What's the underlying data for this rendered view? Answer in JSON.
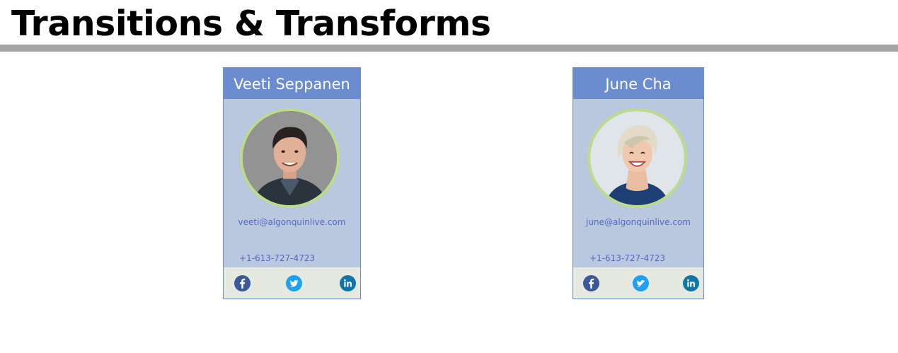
{
  "page": {
    "title": "Transitions & Transforms"
  },
  "cards": [
    {
      "name": "Veeti Seppanen",
      "email": "veeti@algonquinlive.com",
      "phone": "+1-613-727-4723"
    },
    {
      "name": "June Cha",
      "email": "june@algonquinlive.com",
      "phone": "+1-613-727-4723"
    }
  ],
  "icons": {
    "facebook": "facebook-icon",
    "twitter": "twitter-icon",
    "linkedin": "linkedin-icon"
  },
  "colors": {
    "card_header": "#6b8ccf",
    "card_body": "#b9c7df",
    "social_bar": "#e6e9df",
    "avatar_ring": "#bcdc8c",
    "contact_text": "#5468c0",
    "facebook": "#3b5998",
    "twitter": "#1da1f2",
    "linkedin": "#0e76a8"
  }
}
